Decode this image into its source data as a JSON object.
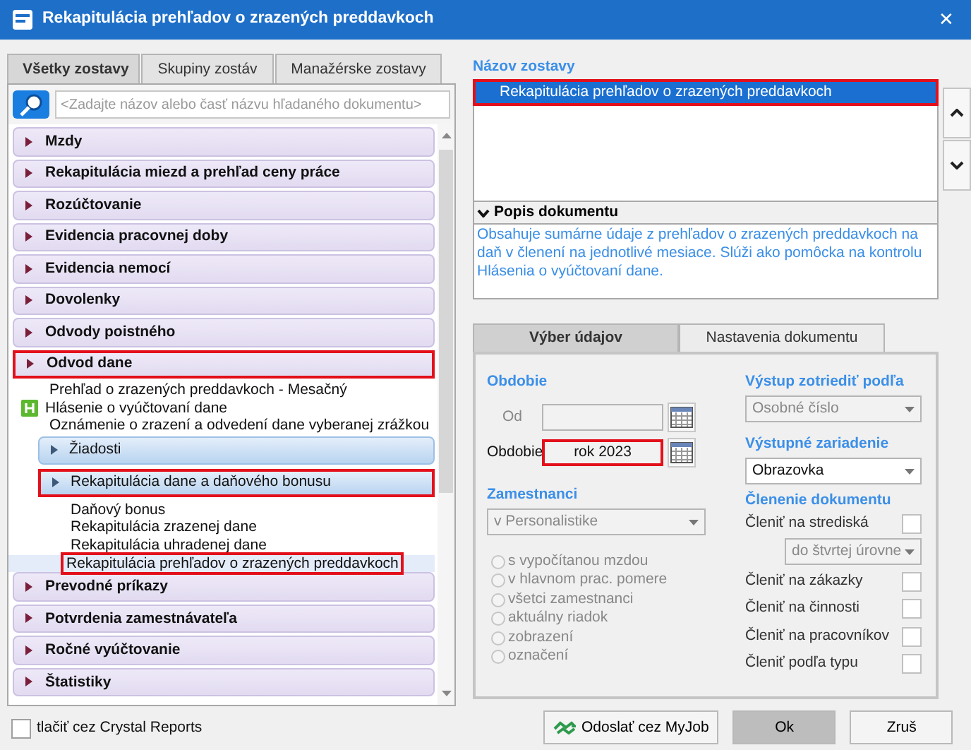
{
  "window": {
    "title": "Rekapitulácia prehľadov o zrazených preddavkoch",
    "close": "✕"
  },
  "left_tabs": [
    {
      "label": "Všetky zostavy",
      "selected": true
    },
    {
      "label": "Skupiny zostáv",
      "selected": false
    },
    {
      "label": "Manažérske zostavy",
      "selected": false
    }
  ],
  "search": {
    "placeholder": "<Zadajte názov alebo časť názvu hľadaného dokumentu>"
  },
  "tree": [
    {
      "kind": "group",
      "label": "Mzdy",
      "highlighted": false
    },
    {
      "kind": "group",
      "label": "Rekapitulácia miezd a prehľad ceny práce",
      "highlighted": false
    },
    {
      "kind": "group",
      "label": "Rozúčtovanie",
      "highlighted": false
    },
    {
      "kind": "group",
      "label": "Evidencia pracovnej doby",
      "highlighted": false
    },
    {
      "kind": "group",
      "label": "Evidencia nemocí",
      "highlighted": false
    },
    {
      "kind": "group",
      "label": "Dovolenky",
      "highlighted": false
    },
    {
      "kind": "group",
      "label": "Odvody poistného",
      "highlighted": false
    },
    {
      "kind": "group",
      "label": "Odvod dane",
      "highlighted": true,
      "children": [
        {
          "kind": "document",
          "label": "Prehľad o zrazených  preddavkoch - Mesačný",
          "icon": false,
          "selected": false,
          "highlighted": false
        },
        {
          "kind": "document",
          "label": "Hlásenie o vyúčtovaní dane",
          "icon": true,
          "selected": false,
          "highlighted": false
        },
        {
          "kind": "document",
          "label": "Oznámenie o zrazení a odvedení dane vyberanej zrážkou",
          "icon": false,
          "selected": false,
          "highlighted": false
        },
        {
          "kind": "subgroup",
          "label": "Žiadosti",
          "highlighted": false
        },
        {
          "kind": "subgroup",
          "label": "Rekapitulácia dane a daňového bonusu",
          "highlighted": true,
          "children": [
            {
              "kind": "document",
              "label": "Daňový bonus",
              "icon": false,
              "selected": false,
              "highlighted": false
            },
            {
              "kind": "document",
              "label": "Rekapitulácia zrazenej dane",
              "icon": false,
              "selected": false,
              "highlighted": false
            },
            {
              "kind": "document",
              "label": "Rekapitulácia uhradenej dane",
              "icon": false,
              "selected": false,
              "highlighted": false
            },
            {
              "kind": "document",
              "label": "Rekapitulácia prehľadov o zrazených preddavkoch",
              "icon": false,
              "selected": true,
              "highlighted": true
            }
          ]
        }
      ]
    },
    {
      "kind": "group",
      "label": "Prevodné príkazy",
      "highlighted": false
    },
    {
      "kind": "group",
      "label": "Potvrdenia zamestnávateľa",
      "highlighted": false
    },
    {
      "kind": "group",
      "label": "Ročné vyúčtovanie",
      "highlighted": false
    },
    {
      "kind": "group",
      "label": "Štatistiky",
      "highlighted": false
    }
  ],
  "crystal": {
    "label": "tlačiť cez Crystal Reports",
    "checked": false
  },
  "report_name": {
    "label": "Názov zostavy",
    "items": [
      {
        "label": "Rekapitulácia prehľadov o zrazených preddavkoch",
        "selected": true,
        "highlighted": true
      }
    ]
  },
  "description": {
    "title": "Popis dokumentu",
    "expanded": true,
    "text": "Obsahuje sumárne údaje z prehľadov o zrazených preddavkoch na daň v členení na jednotlivé mesiace. Slúži ako pomôcka na kontrolu Hlásenia o vyúčtovaní dane."
  },
  "right_tabs": [
    {
      "label": "Výber údajov",
      "selected": true
    },
    {
      "label": "Nastavenia dokumentu",
      "selected": false
    }
  ],
  "period": {
    "title": "Obdobie",
    "from": {
      "label": "Od",
      "disabled": true
    },
    "period": {
      "label": "Obdobie",
      "value": "rok 2023",
      "highlighted": true
    }
  },
  "employees": {
    "title": "Zamestnanci",
    "select": "v Personalistike",
    "disabled": true,
    "radios": [
      {
        "label": "s vypočítanou mzdou",
        "selected": false
      },
      {
        "label": "v hlavnom prac. pomere",
        "selected": false
      },
      {
        "label": "všetci zamestnanci",
        "selected": false
      },
      {
        "label": "aktuálny riadok",
        "selected": false
      },
      {
        "label": "zobrazení",
        "selected": false
      },
      {
        "label": "označení",
        "selected": false
      }
    ]
  },
  "sort": {
    "title": "Výstup zotriediť podľa",
    "value": "Osobné číslo",
    "disabled": true
  },
  "device": {
    "title": "Výstupné zariadenie",
    "value": "Obrazovka",
    "disabled": false
  },
  "breakdown": {
    "title": "Členenie dokumentu",
    "rows": [
      {
        "kind": "checkbox",
        "label": "Členiť na strediská",
        "checked": false
      },
      {
        "kind": "select",
        "value": "do štvrtej úrovne",
        "disabled": true
      },
      {
        "kind": "checkbox",
        "label": "Členiť na zákazky",
        "checked": false
      },
      {
        "kind": "checkbox",
        "label": "Členiť na činnosti",
        "checked": false
      },
      {
        "kind": "checkbox",
        "label": "Členiť na pracovníkov",
        "checked": false
      },
      {
        "kind": "checkbox",
        "label": "Členiť podľa typu",
        "checked": false
      }
    ]
  },
  "buttons": [
    {
      "kind": "myjob",
      "label": "Odoslať cez MyJob"
    },
    {
      "kind": "primary",
      "label": "Ok"
    },
    {
      "kind": "plain",
      "label": "Zruš"
    }
  ]
}
